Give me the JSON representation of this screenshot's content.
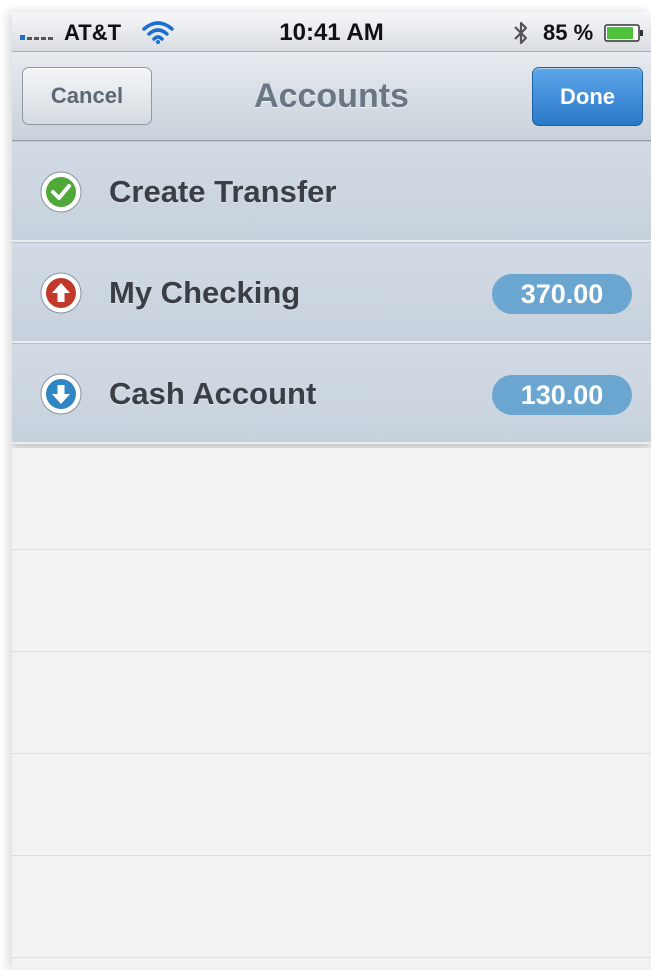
{
  "status_bar": {
    "carrier": "AT&T",
    "time": "10:41 AM",
    "battery_percent": "85 %",
    "icons": [
      "signal-bars-icon",
      "wifi-icon",
      "bluetooth-icon",
      "battery-icon"
    ]
  },
  "nav": {
    "cancel_label": "Cancel",
    "title": "Accounts",
    "done_label": "Done"
  },
  "rows": [
    {
      "label": "Create Transfer",
      "icon": "check-circle-icon",
      "icon_color": "#4fa838"
    },
    {
      "label": "My Checking",
      "icon": "arrow-up-circle-icon",
      "icon_color": "#c1392b",
      "amount": "370.00"
    },
    {
      "label": "Cash Account",
      "icon": "arrow-down-circle-icon",
      "icon_color": "#2f86c2",
      "amount": "130.00"
    }
  ],
  "colors": {
    "done_button": "#2a79c9",
    "amount_badge": "#6aa6cf",
    "row_background": "#ccd6e0"
  }
}
